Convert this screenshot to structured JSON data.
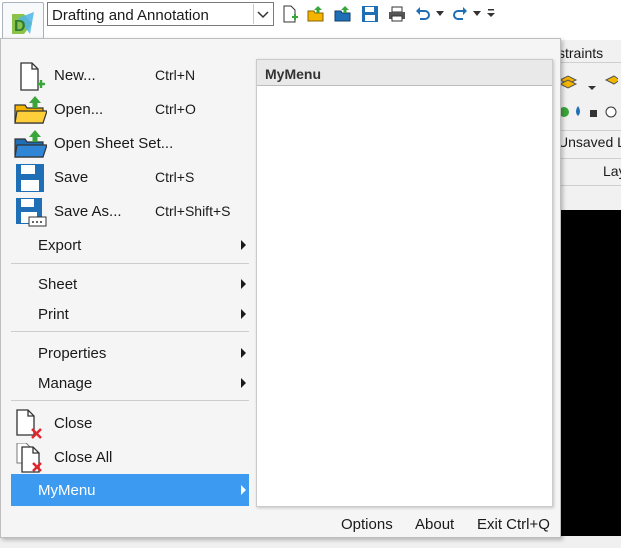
{
  "quick_access": {
    "workspace_value": "Drafting and Annotation",
    "icons": [
      "app-logo-icon",
      "new-icon",
      "open-icon",
      "open-sheet-set-icon",
      "save-icon",
      "print-icon",
      "undo-icon",
      "redo-icon",
      "customize-icon"
    ]
  },
  "ribbon_background": {
    "tab_fragment": "straints",
    "layer_state": "Unsaved L",
    "panel_fragment": "Lay"
  },
  "menu": {
    "new": {
      "label": "New...",
      "shortcut": "Ctrl+N"
    },
    "open": {
      "label": "Open...",
      "shortcut": "Ctrl+O"
    },
    "open_sheet_set": {
      "label": "Open Sheet Set..."
    },
    "save": {
      "label": "Save",
      "shortcut": "Ctrl+S"
    },
    "save_as": {
      "label": "Save As...",
      "shortcut": "Ctrl+Shift+S"
    },
    "export": {
      "label": "Export"
    },
    "sheet": {
      "label": "Sheet"
    },
    "print": {
      "label": "Print"
    },
    "properties": {
      "label": "Properties"
    },
    "manage": {
      "label": "Manage"
    },
    "close": {
      "label": "Close"
    },
    "close_all": {
      "label": "Close All"
    },
    "mymenu": {
      "label": "MyMenu"
    }
  },
  "submenu": {
    "title": "MyMenu"
  },
  "footer": {
    "options": "Options",
    "about": "About",
    "exit": "Exit Ctrl+Q"
  },
  "colors": {
    "highlight": "#3c9bf0",
    "icon_blue": "#1e6fb5",
    "icon_green": "#3aa53a",
    "folder_yellow": "#f4b400",
    "close_red": "#e0262d"
  }
}
